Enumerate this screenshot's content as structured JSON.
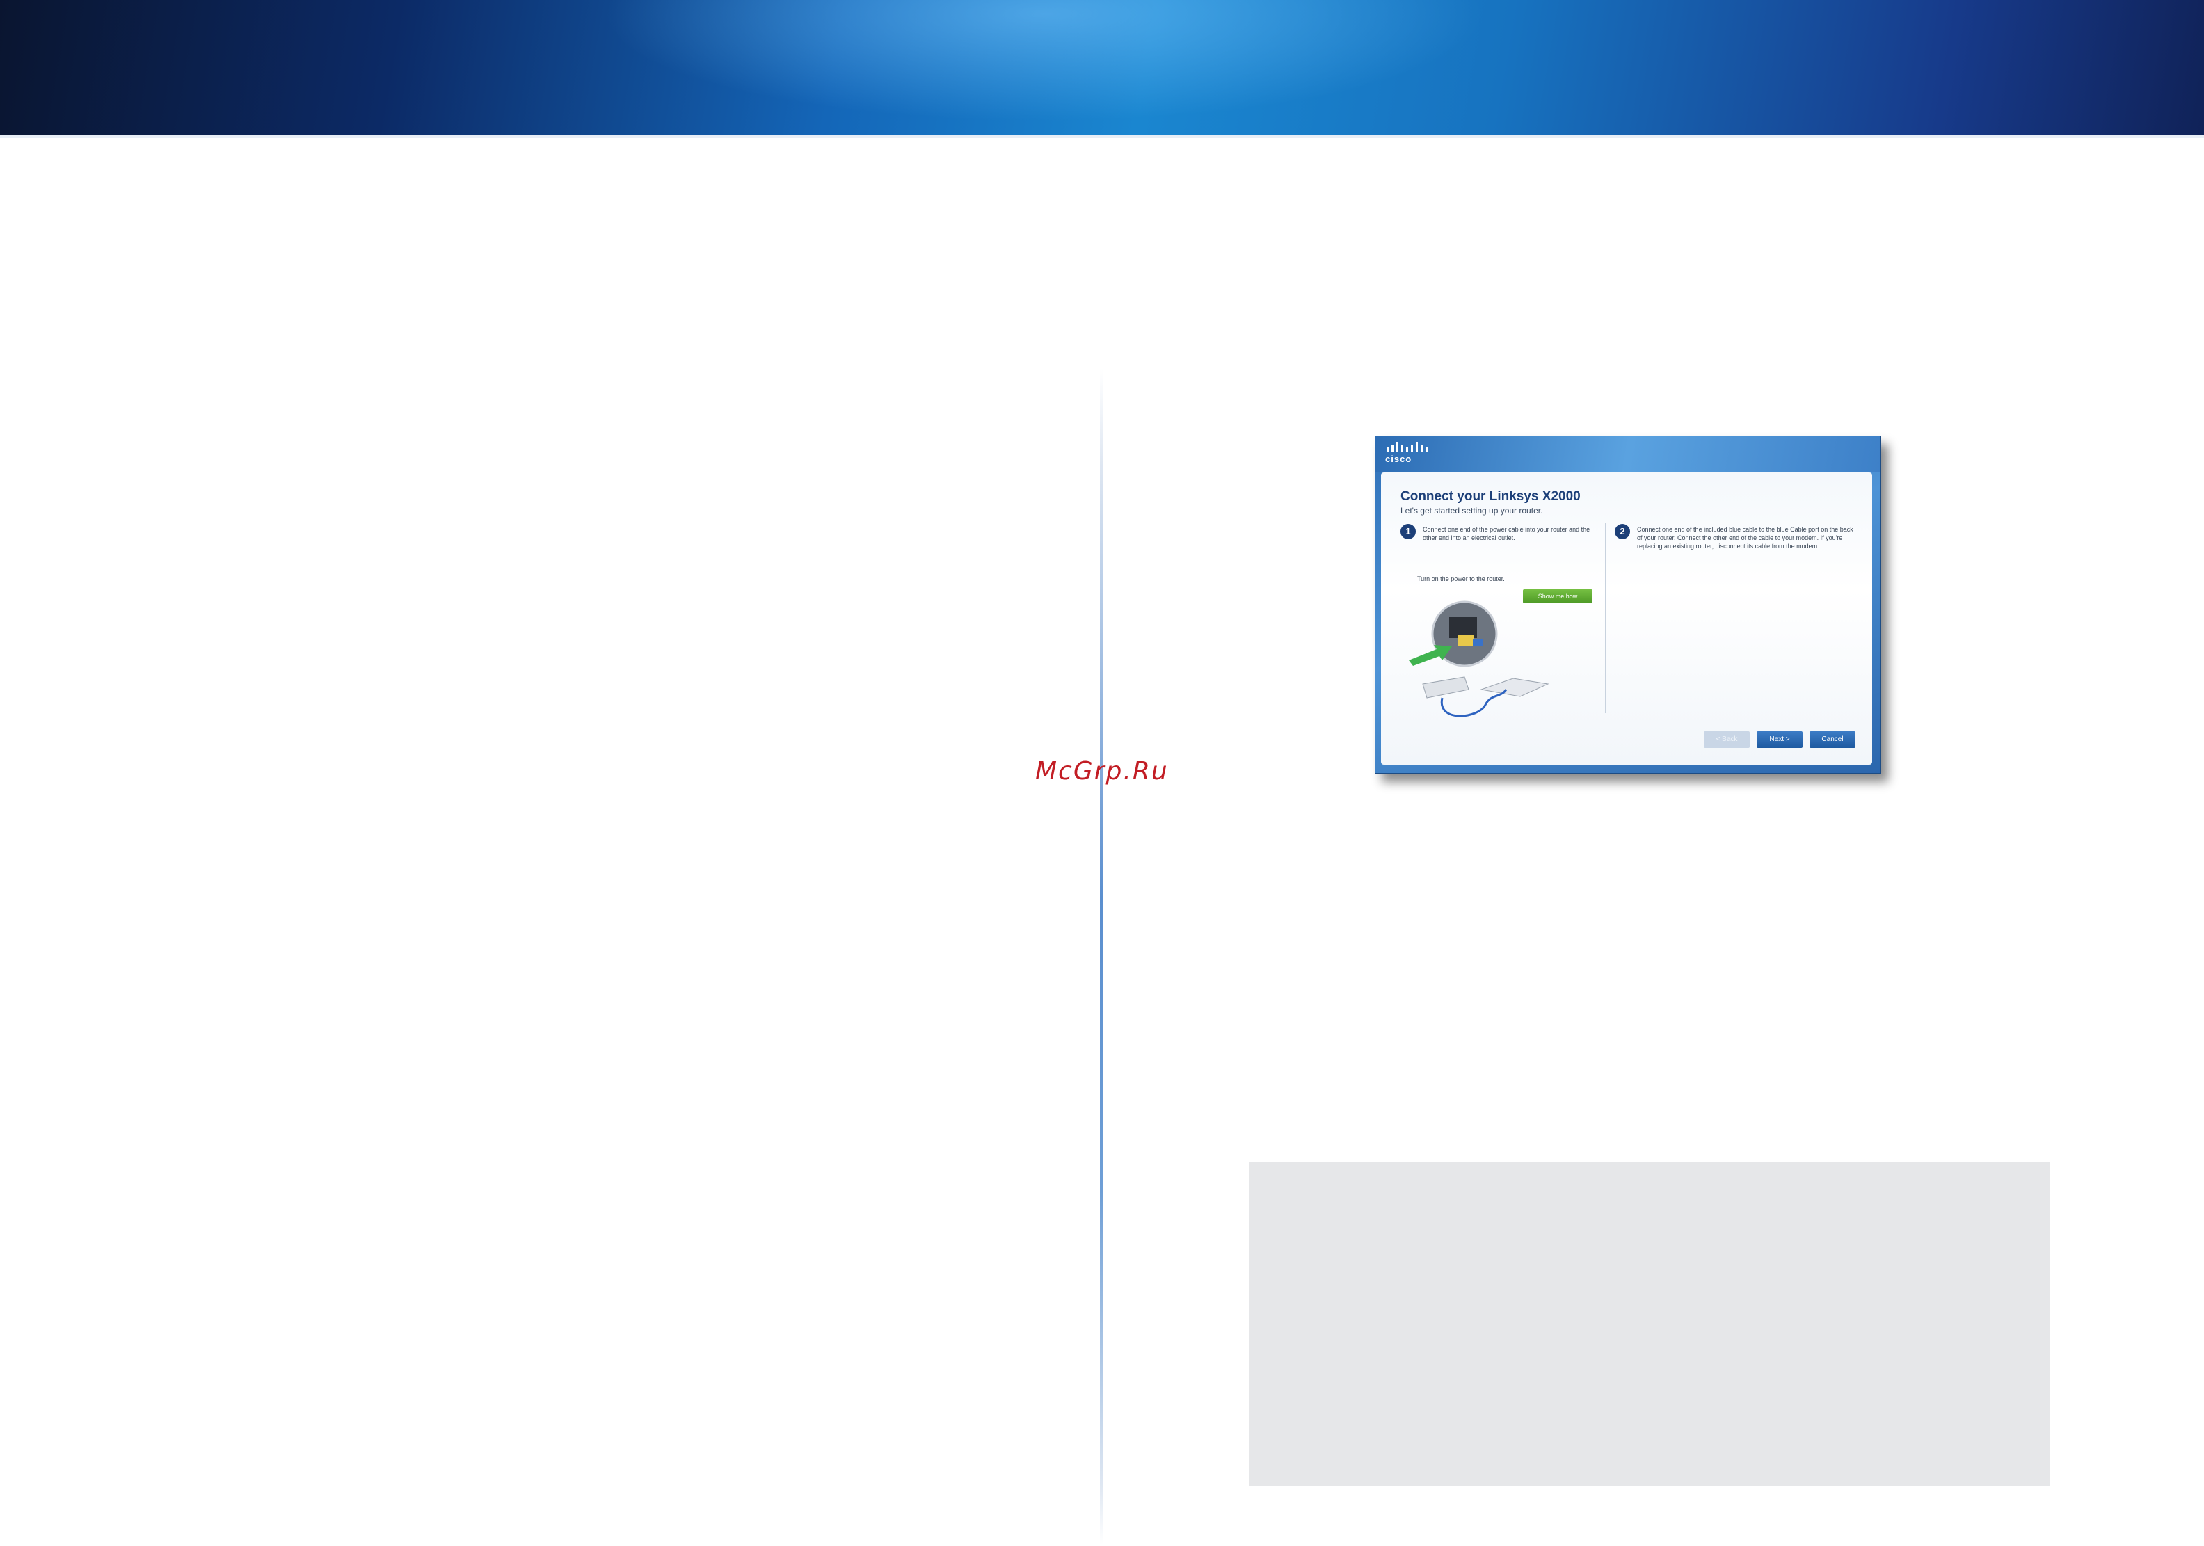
{
  "watermark": "McGrp.Ru",
  "setup_window": {
    "logo_text": "cisco",
    "title": "Connect your Linksys X2000",
    "subtitle": "Let's get started setting up your router.",
    "step1": {
      "number": "1",
      "text": "Connect one end of the power cable into your router and the other end into an electrical outlet.",
      "note": "Turn on the power to the router.",
      "button": "Show me how"
    },
    "step2": {
      "number": "2",
      "text": "Connect one end of the included blue cable to the blue Cable port on the back of your router. Connect the other end of the cable to your modem. If you're replacing an existing router, disconnect its cable from the modem."
    },
    "buttons": {
      "back": "< Back",
      "next": "Next >",
      "cancel": "Cancel"
    }
  }
}
